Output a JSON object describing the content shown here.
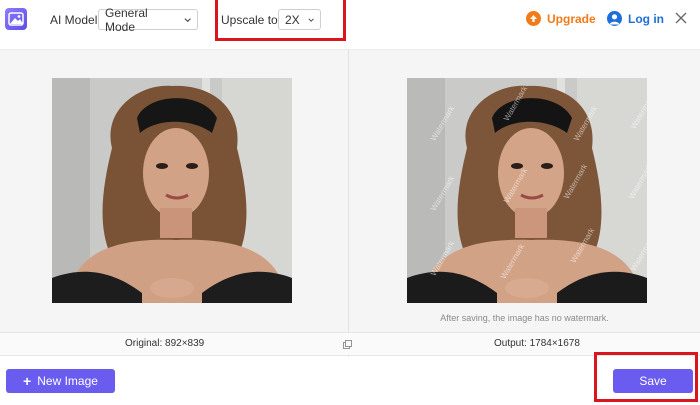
{
  "header": {
    "ai_model_label": "AI Model:",
    "ai_model_value": "General Mode",
    "upscale_label": "Upscale to:",
    "upscale_value": "2X",
    "upgrade_label": "Upgrade",
    "login_label": "Log in"
  },
  "preview": {
    "watermark_text": "Watermark",
    "watermark_note": "After saving, the image has no watermark.",
    "original_info": "Original: 892×839",
    "output_info": "Output: 1784×1678"
  },
  "actions": {
    "new_image_label": "New Image",
    "save_label": "Save"
  },
  "colors": {
    "accent": "#6b5cf0",
    "upgrade": "#f27a18",
    "login": "#1f6fd9",
    "highlight": "#d9151e"
  },
  "icons": [
    "app-logo-icon",
    "chevron-down-icon",
    "upgrade-icon",
    "user-icon",
    "close-icon",
    "copy-icon",
    "plus-icon"
  ]
}
